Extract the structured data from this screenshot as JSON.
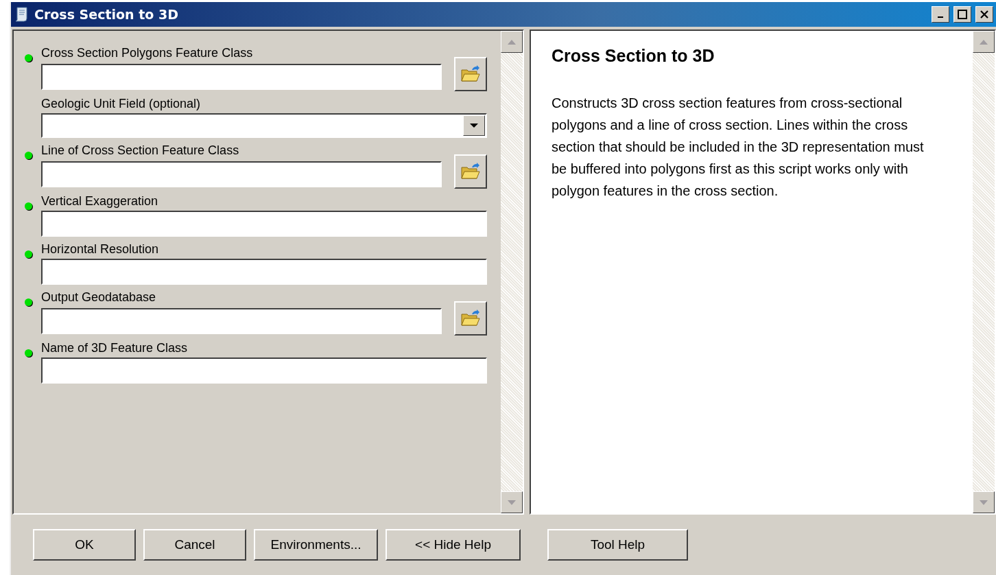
{
  "window": {
    "title": "Cross Section to 3D"
  },
  "parameters": [
    {
      "label": "Cross Section Polygons Feature Class",
      "kind": "text",
      "required": true,
      "browse": true
    },
    {
      "label": "Geologic Unit Field (optional)",
      "kind": "dropdown",
      "required": false,
      "browse": false
    },
    {
      "label": "Line of Cross Section Feature Class",
      "kind": "text",
      "required": true,
      "browse": true
    },
    {
      "label": "Vertical Exaggeration",
      "kind": "text",
      "required": true,
      "browse": false
    },
    {
      "label": "Horizontal Resolution",
      "kind": "text",
      "required": true,
      "browse": false
    },
    {
      "label": "Output Geodatabase",
      "kind": "text",
      "required": true,
      "browse": true
    },
    {
      "label": "Name of 3D Feature Class",
      "kind": "text",
      "required": true,
      "browse": false
    }
  ],
  "help": {
    "title": "Cross Section to 3D",
    "text": "Constructs 3D cross section features from cross-sectional polygons and a line of cross section. Lines within the cross section that should be included in the 3D representation must be buffered into polygons first as this script works only with polygon features in the cross section."
  },
  "buttons": [
    "OK",
    "Cancel",
    "Environments...",
    "<< Hide Help"
  ],
  "help_button": "Tool Help"
}
